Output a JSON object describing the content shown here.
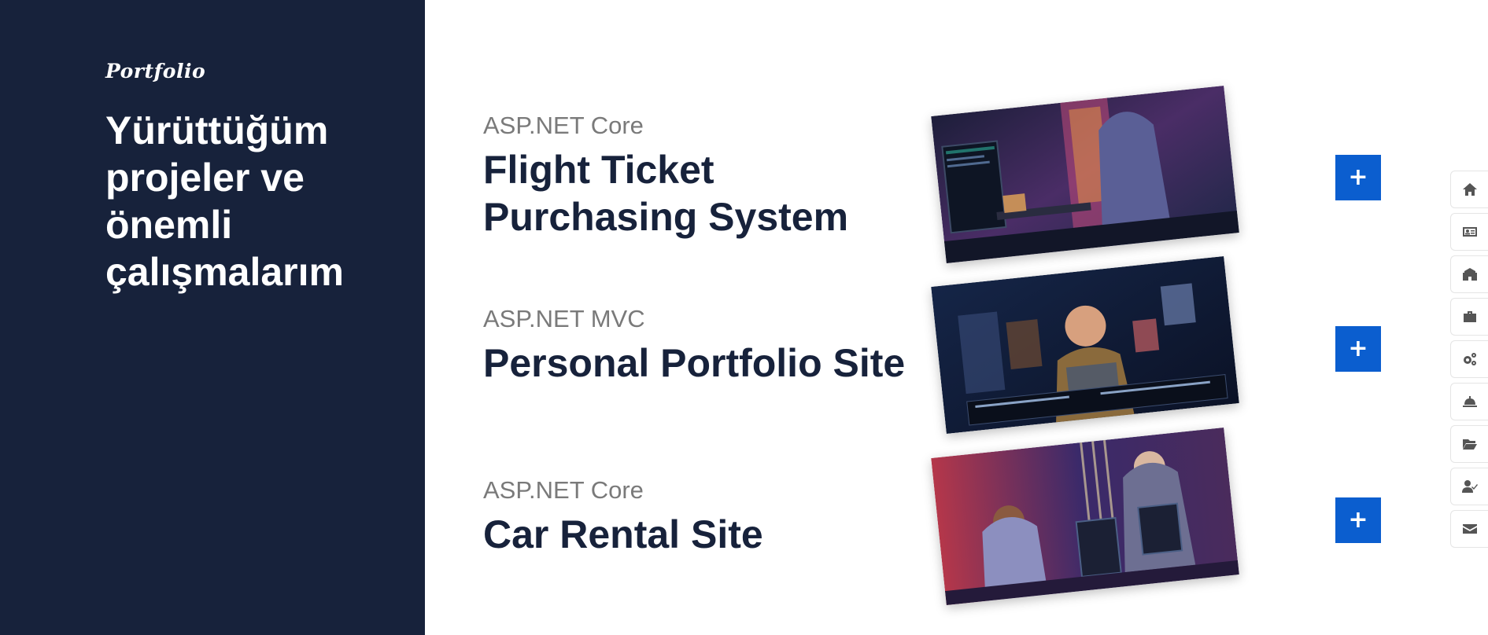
{
  "sidebar": {
    "eyebrow": "Portfolio",
    "heading": "Yürüttüğüm projeler ve önemli çalışmalarım"
  },
  "projects": [
    {
      "category": "ASP.NET Core",
      "title": "Flight Ticket Purchasing System",
      "button_label": "+"
    },
    {
      "category": "ASP.NET MVC",
      "title": "Personal Portfolio Site",
      "button_label": "+"
    },
    {
      "category": "ASP.NET Core",
      "title": "Car Rental Site",
      "button_label": "+"
    }
  ],
  "side_nav": [
    "home-icon",
    "id-card-icon",
    "building-icon",
    "briefcase-icon",
    "gears-icon",
    "service-bell-icon",
    "folder-open-icon",
    "user-check-icon",
    "envelope-icon"
  ],
  "colors": {
    "sidebar_bg": "#17223b",
    "accent": "#0b5ecf",
    "category_text": "#7a7a7a",
    "title_text": "#17223b"
  }
}
